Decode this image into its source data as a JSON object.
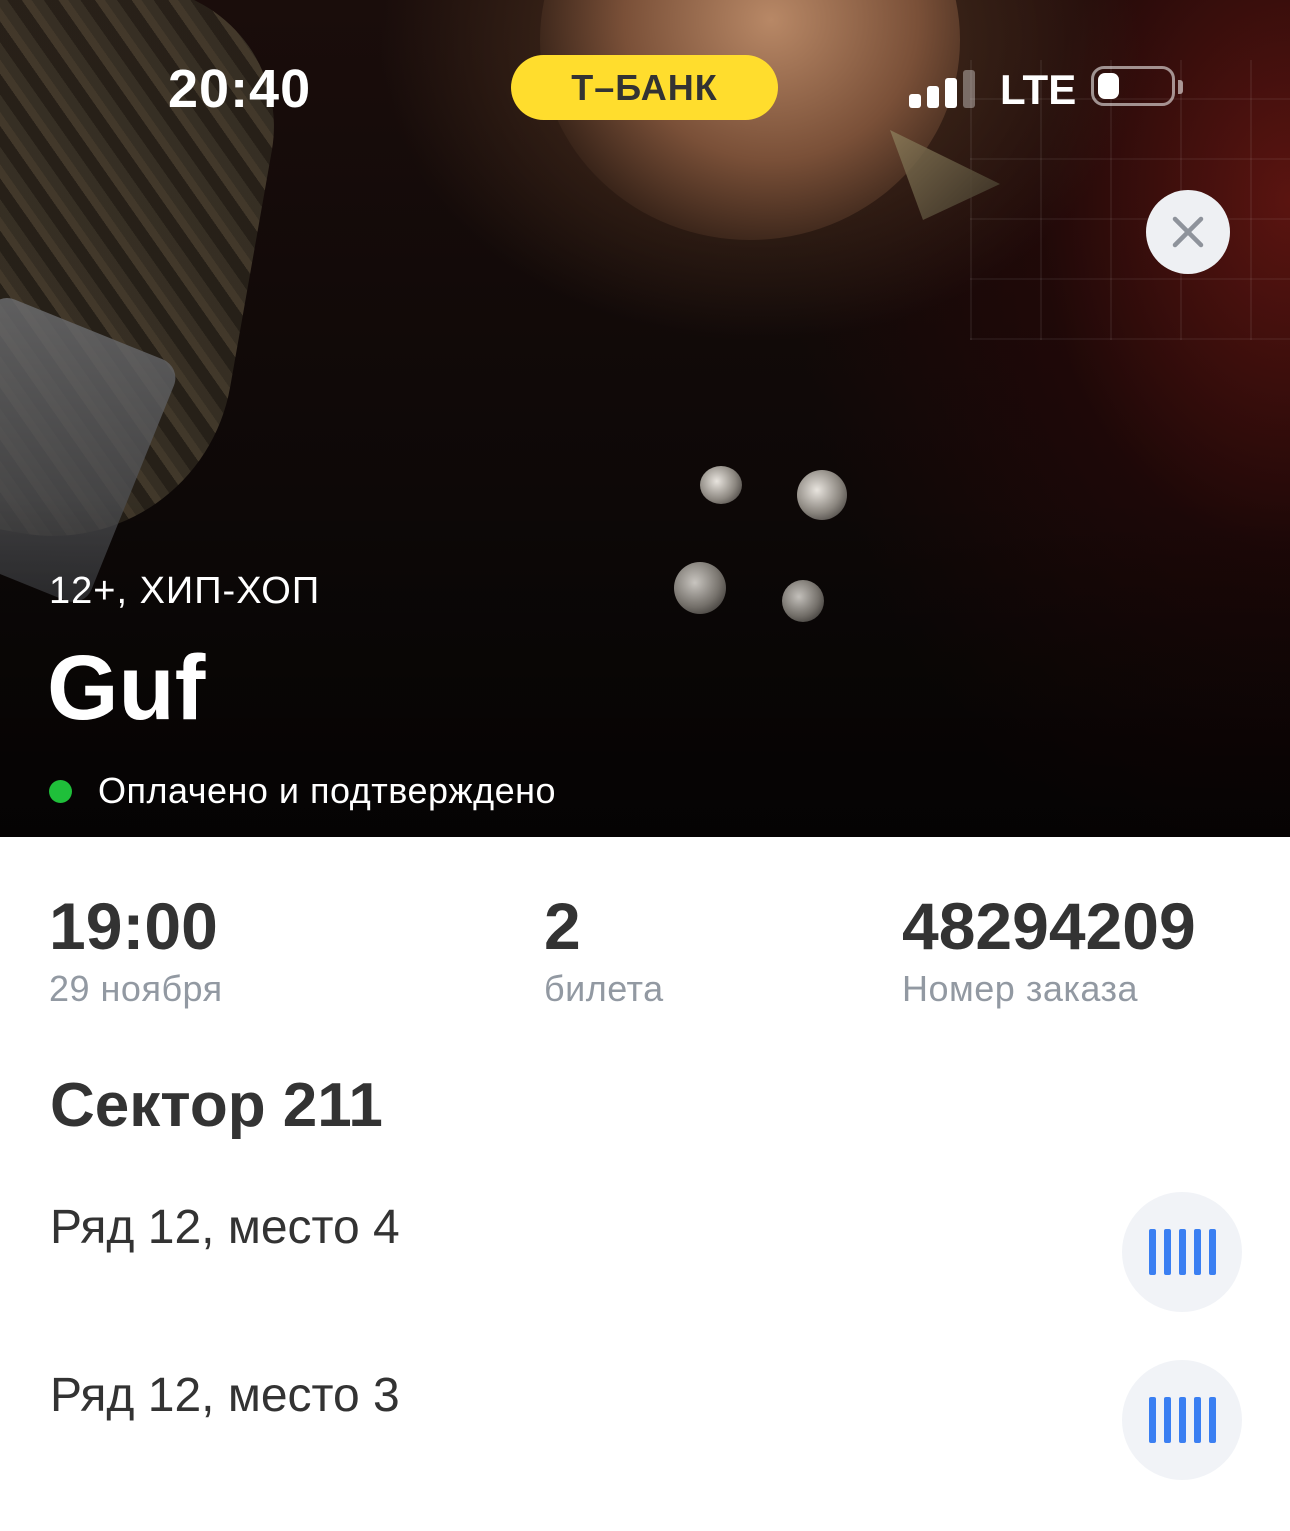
{
  "status_bar": {
    "time": "20:40",
    "carrier_badge": "Т–БАНК",
    "network": "LTE",
    "signal_bars_active": 3,
    "signal_bars_total": 4,
    "battery_level": 0.3
  },
  "event": {
    "genre": "12+, ХИП-ХОП",
    "title": "Guf",
    "status": "Оплачено и подтверждено",
    "status_color": "#1fbf3a"
  },
  "summary": {
    "time": {
      "value": "19:00",
      "label": "29 ноября"
    },
    "tickets": {
      "value": "2",
      "label": "билета"
    },
    "order": {
      "value": "48294209",
      "label": "Номер заказа"
    }
  },
  "sector": "Сектор 211",
  "seats": [
    {
      "label": "Ряд 12, место 4"
    },
    {
      "label": "Ряд 12, место 3"
    }
  ],
  "colors": {
    "accent_yellow": "#ffdd2d",
    "barcode_blue": "#3b7ff2",
    "text_primary": "#333333",
    "text_secondary": "#9299a2"
  },
  "icons": {
    "close": "close-icon",
    "barcode": "barcode-icon"
  }
}
